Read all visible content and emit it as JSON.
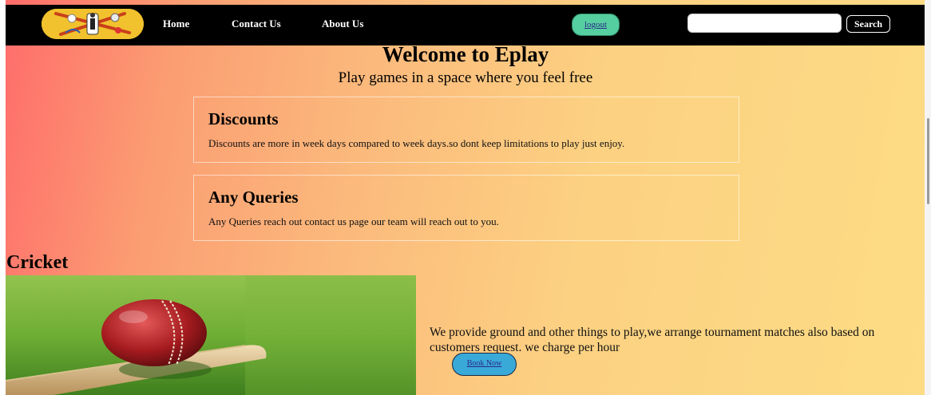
{
  "nav": {
    "home": "Home",
    "contact": "Contact Us",
    "about": "About Us",
    "logout": "logout",
    "search_value": "",
    "search_button": "Search"
  },
  "hero": {
    "title": "Welcome to Eplay",
    "subtitle": "Play games in a space where you feel free"
  },
  "cards": [
    {
      "heading": "Discounts",
      "text": "Discounts are more in week days compared to week days.so dont keep limitations to play just enjoy."
    },
    {
      "heading": "Any Queries",
      "text": "Any Queries reach out contact us page our team will reach out to you."
    }
  ],
  "cricket": {
    "title": "Cricket",
    "description": "We provide ground and other things to play,we arrange tournament matches also based on customers request. we charge per hour",
    "book_button": "Book Now"
  },
  "colors": {
    "navbar": "#000000",
    "logout_button": "#56cfa0",
    "book_button": "#39a9d8",
    "logo_badge": "#f2c12e"
  }
}
